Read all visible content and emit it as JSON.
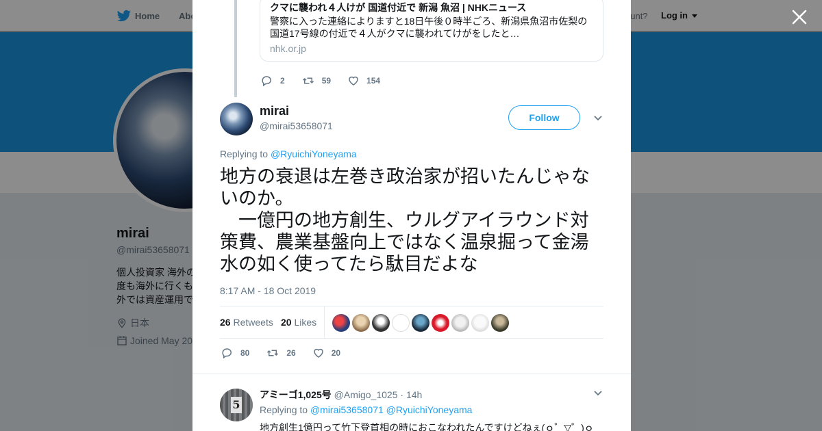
{
  "topbar": {
    "home_label": "Home",
    "about_label": "Abo",
    "account_prompt": "ccount?",
    "login_label": "Log in"
  },
  "profile": {
    "name": "mirai",
    "handle": "@mirai53658071",
    "bio": "個人投資家 海外の 度も海外に行くも 外では資産運用で",
    "location": "日本",
    "joined": "Joined May 20"
  },
  "quoted_card": {
    "title": "クマに襲われ４人けが 国道付近で 新潟 魚沼 | NHKニュース",
    "description": "警察に入った連絡によりますと18日午後０時半ごろ、新潟県魚沼市佐梨の国道17号線の付近で４人がクマに襲われてけがをしたと…",
    "domain": "nhk.or.jp"
  },
  "prev_actions": {
    "replies": "2",
    "retweets": "59",
    "likes": "154"
  },
  "tweet": {
    "name": "mirai",
    "handle": "@mirai53658071",
    "follow_label": "Follow",
    "replying_prefix": "Replying to",
    "replying_to": "@RyuichiYoneyama",
    "text": "地方の衰退は左巻き政治家が招いたんじゃないのか。\n　一億円の地方創生、ウルグアイラウンド対策費、農業基盤向上ではなく温泉掘って金湯水の如く使ってたら駄目だよな",
    "timestamp": "8:17 AM - 18 Oct 2019",
    "retweets_count": "26",
    "retweets_label": "Retweets",
    "likes_count": "20",
    "likes_label": "Likes",
    "actions": {
      "replies": "80",
      "retweets": "26",
      "likes": "20"
    }
  },
  "reply": {
    "name": "アミーゴ1,025号",
    "handle": "@Amigo_1025",
    "time": "14h",
    "avatar_number": "5",
    "replying_prefix": "Replying to",
    "mention_1": "@mirai53658071",
    "mention_2": "@RyuichiYoneyama",
    "text": "地方創生1億円って竹下登首相の時におこなわれたんですけどねぇ(ｏ゜▽゜)ｏ"
  },
  "colors": {
    "brand": "#1da1f2",
    "banner": "#1b95e0",
    "text": "#14171a",
    "secondary": "#657786"
  },
  "icons": [
    "twitter-bird-icon",
    "close-icon",
    "reply-icon",
    "retweet-icon",
    "heart-icon",
    "chevron-down-icon",
    "location-icon",
    "calendar-icon"
  ]
}
